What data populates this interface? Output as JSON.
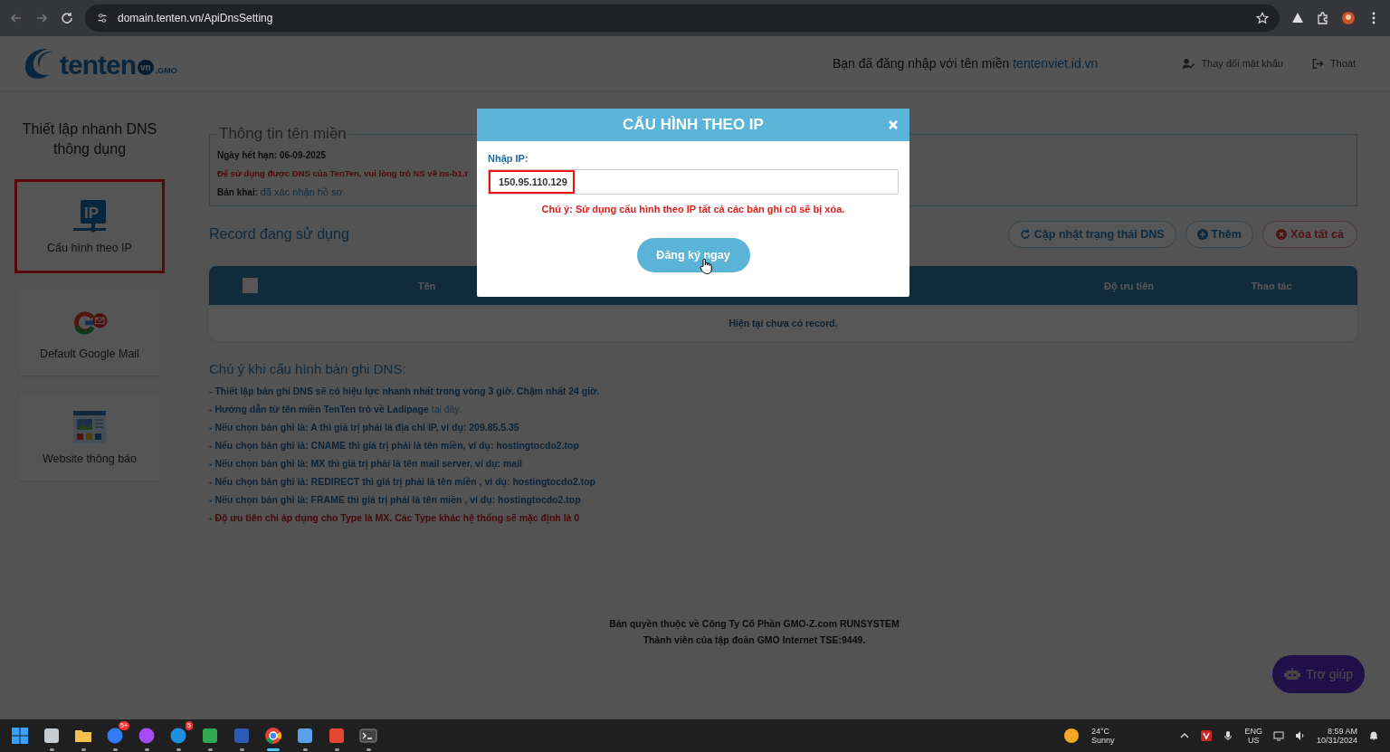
{
  "browser": {
    "url": "domain.tenten.vn/ApiDnsSetting"
  },
  "header": {
    "logo": {
      "name": "tenten",
      "badge": "vn",
      "suffix": ".GMO"
    },
    "login_text": "Bạn đã đăng nhập với tên miền",
    "login_domain": "tentenviet.id.vn",
    "links": [
      {
        "kind": "password",
        "label": "Thay đổi mật khẩu"
      },
      {
        "kind": "logout",
        "label": "Thoát"
      }
    ]
  },
  "sidebar": {
    "title": "Thiết lập nhanh DNS thông dụng",
    "items": [
      {
        "kind": "ip",
        "icon_text": "IP",
        "label": "Cấu hình theo IP",
        "selected": true
      },
      {
        "kind": "google",
        "label": "Default Google Mail",
        "selected": false
      },
      {
        "kind": "website",
        "label": "Website thông báo",
        "selected": false
      }
    ]
  },
  "domain_info": {
    "legend": "Thông tin tên miền",
    "expiry_label": "Ngày hết hạn:",
    "expiry": "06-09-2025",
    "warning": "Để sử dụng được DNS của TenTen, vui lòng trỏ NS về ns-b1.t",
    "status_label": "Bản khai:",
    "status": "đã xác nhận hồ sơ"
  },
  "records": {
    "title": "Record đang sử dụng",
    "buttons": [
      {
        "kind": "refresh",
        "label": "Cập nhật trạng thái DNS"
      },
      {
        "kind": "add",
        "label": "Thêm"
      },
      {
        "kind": "delete",
        "label": "Xóa tất cả"
      }
    ],
    "table": {
      "select_all": false,
      "columns": [
        "Tên",
        "Độ ưu tiên",
        "Thao tác"
      ],
      "empty_text": "Hiện tại chưa có record."
    }
  },
  "notes": {
    "title": "Chú ý khi cấu hình bản ghi DNS:",
    "items": [
      {
        "kind": "info",
        "text": "- Thiết lập bản ghi DNS sẽ có hiệu lực nhanh nhất trong vòng 3 giờ. Chậm nhất 24 giờ."
      },
      {
        "kind": "info",
        "text": "- Hướng dẫn từ tên miền TenTen trỏ về Ladipage",
        "link": "tại đây."
      },
      {
        "kind": "info",
        "text": "- Nếu chọn bản ghi là: A thì giá trị phải là địa chỉ IP, ví dụ: 209.85.5.35"
      },
      {
        "kind": "info",
        "text": "- Nếu chọn bản ghi là: CNAME thì giá trị phải là tên miền, ví dụ: hostingtocdo2.top"
      },
      {
        "kind": "info",
        "text": "- Nếu chọn bản ghi là: MX thì giá trị phải là tên mail server, ví dụ: mail"
      },
      {
        "kind": "info",
        "text": "- Nếu chọn bản ghi là: REDIRECT thì giá trị phải là tên miền , ví dụ: hostingtocdo2.top"
      },
      {
        "kind": "info",
        "text": "- Nếu chọn bản ghi là: FRAME thì giá trị phải là tên miền , ví dụ: hostingtocdo2.top"
      },
      {
        "kind": "warning",
        "text": "- Độ ưu tiên chỉ áp dụng cho Type là MX. Các Type khác hệ thống sẽ mặc định là 0"
      }
    ]
  },
  "footer": {
    "lines": [
      "Bản quyền thuộc về Công Ty Cổ Phần GMO-Z.com RUNSYSTEM",
      "Thành viên của tập đoàn GMO Internet TSE:9449."
    ]
  },
  "help_button": {
    "label": "Trợ giúp"
  },
  "modal": {
    "title": "CẤU HÌNH THEO IP",
    "field_label": "Nhập IP:",
    "value": "150.95.110.129",
    "warning": "Chú ý: Sử dụng cấu hình theo IP tất cả các bản ghi cũ sẽ bị xóa.",
    "submit": "Đăng ký ngay"
  },
  "taskbar": {
    "apps": [
      {
        "kind": "taskview",
        "selected": false
      },
      {
        "kind": "folder",
        "selected": false
      },
      {
        "kind": "chat",
        "badge": "5+",
        "selected": false
      },
      {
        "kind": "messenger",
        "selected": false
      },
      {
        "kind": "skype",
        "badge": "5",
        "selected": false
      },
      {
        "kind": "greenapp",
        "selected": false
      },
      {
        "kind": "word",
        "selected": false
      },
      {
        "kind": "chrome",
        "selected": true
      },
      {
        "kind": "notepad",
        "selected": false
      },
      {
        "kind": "redapp",
        "selected": false
      },
      {
        "kind": "terminal",
        "selected": false
      }
    ],
    "weather": {
      "temp": "24°C",
      "condition": "Sunny"
    },
    "language": [
      "ENG",
      "US"
    ],
    "time": "8:59 AM",
    "date": "10/31/2024"
  }
}
